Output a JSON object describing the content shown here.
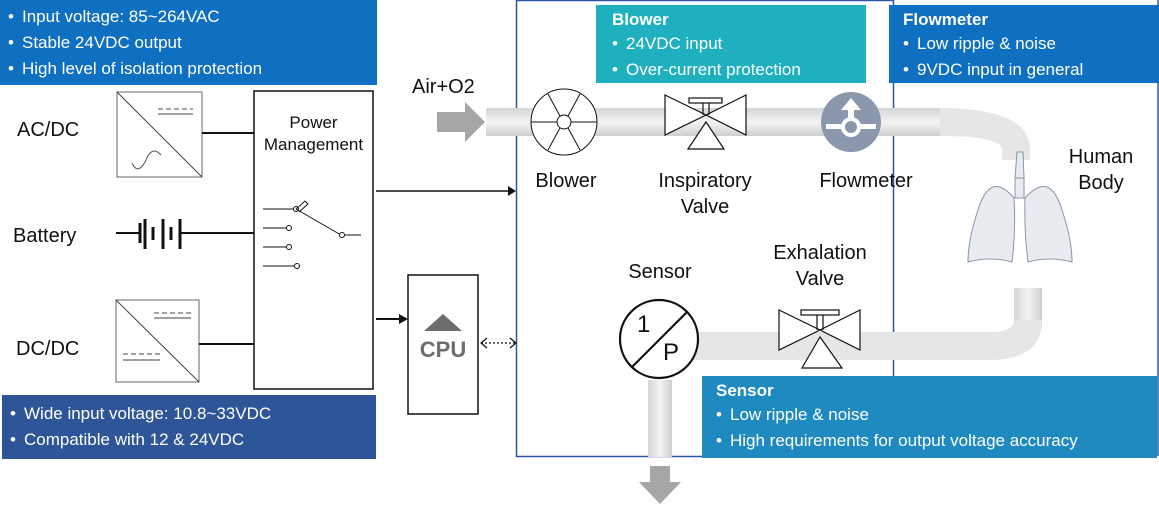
{
  "callouts": {
    "acdc": {
      "items": [
        "Input voltage: 85~264VAC",
        "Stable 24VDC output",
        "High level of isolation protection"
      ],
      "color": "#0f6fc0"
    },
    "dcdc": {
      "items": [
        "Wide input voltage: 10.8~33VDC",
        "Compatible with 12 & 24VDC"
      ],
      "color": "#2e5597"
    },
    "blower": {
      "title": "Blower",
      "items": [
        "24VDC input",
        "Over-current protection"
      ],
      "color": "#1fb0bf"
    },
    "flowmeter": {
      "title": "Flowmeter",
      "items": [
        "Low ripple & noise",
        "9VDC input in general"
      ],
      "color": "#0f6fc0"
    },
    "sensor": {
      "title": "Sensor",
      "items": [
        "Low ripple & noise",
        "High requirements for output voltage accuracy"
      ],
      "color": "#1f8abf"
    }
  },
  "labels": {
    "acdc": "AC/DC",
    "battery": "Battery",
    "dcdc": "DC/DC",
    "power_mgmt_1": "Power",
    "power_mgmt_2": "Management",
    "cpu": "CPU",
    "air_o2": "Air+O2",
    "blower": "Blower",
    "insp_1": "Inspiratory",
    "insp_2": "Valve",
    "flowmeter": "Flowmeter",
    "human_1": "Human",
    "human_2": "Body",
    "sensor": "Sensor",
    "exh_1": "Exhalation",
    "exh_2": "Valve",
    "sensor_num": "1",
    "sensor_den": "P"
  }
}
